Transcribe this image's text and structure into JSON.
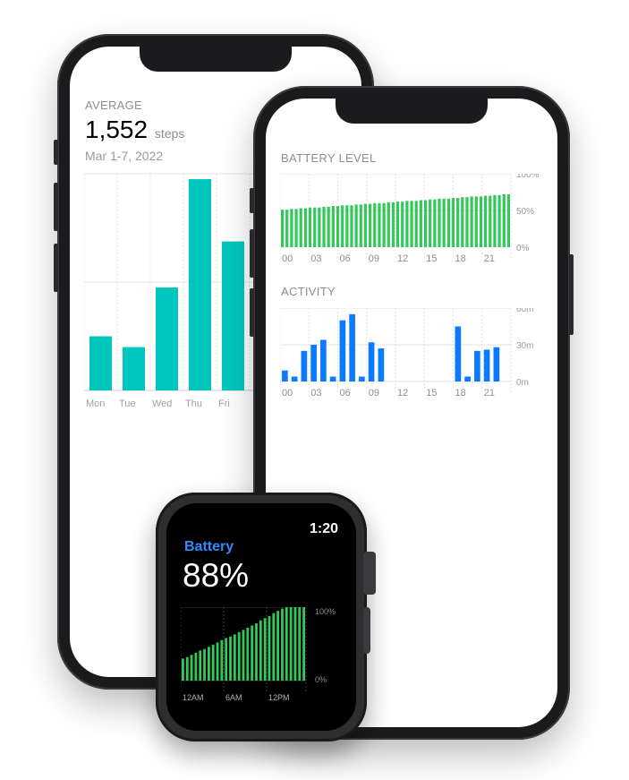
{
  "steps_phone": {
    "label": "AVERAGE",
    "value": "1,552",
    "unit": "steps",
    "date_range": "Mar 1-7, 2022"
  },
  "battery_phone": {
    "battery_title": "BATTERY LEVEL",
    "activity_title": "ACTIVITY"
  },
  "watch": {
    "time": "1:20",
    "title": "Battery",
    "value": "88%"
  },
  "colors": {
    "teal": "#00c7be",
    "green": "#34c759",
    "blue": "#0a7aff",
    "watch_blue": "#2f8cff"
  },
  "chart_data": [
    {
      "type": "bar",
      "categories": [
        "Mon",
        "Tue",
        "Wed",
        "Thu",
        "Fri"
      ],
      "values": [
        1000,
        800,
        1900,
        3900,
        2750
      ],
      "title": "",
      "xlabel": "",
      "ylabel": ""
    },
    {
      "type": "bar",
      "title": "BATTERY LEVEL",
      "x_ticks": [
        "00",
        "03",
        "06",
        "09",
        "12",
        "15",
        "18",
        "21"
      ],
      "y_ticks": [
        "100%",
        "50%",
        "0%"
      ],
      "ylim": [
        0,
        100
      ],
      "values": [
        51,
        51,
        52,
        52,
        53,
        53,
        54,
        54,
        54,
        55,
        55,
        56,
        56,
        57,
        57,
        57,
        58,
        58,
        59,
        59,
        60,
        60,
        60,
        61,
        61,
        62,
        62,
        63,
        63,
        63,
        64,
        64,
        65,
        65,
        66,
        66,
        66,
        67,
        67,
        68,
        68,
        69,
        69,
        69,
        70,
        70,
        71,
        71,
        72,
        72
      ]
    },
    {
      "type": "bar",
      "title": "ACTIVITY",
      "x_ticks": [
        "00",
        "03",
        "06",
        "09",
        "12",
        "15",
        "18",
        "21"
      ],
      "y_ticks": [
        "60m",
        "30m",
        "0m"
      ],
      "ylim": [
        0,
        60
      ],
      "values": [
        9,
        4,
        25,
        30,
        34,
        4,
        50,
        55,
        4,
        32,
        27,
        0,
        0,
        0,
        0,
        0,
        0,
        0,
        45,
        4,
        25,
        26,
        28,
        0
      ]
    },
    {
      "type": "bar",
      "title": "Battery",
      "x_ticks": [
        "12AM",
        "6AM",
        "12PM"
      ],
      "y_ticks": [
        "100%",
        "0%"
      ],
      "ylim": [
        0,
        100
      ],
      "values": [
        30,
        32,
        35,
        38,
        41,
        43,
        46,
        49,
        52,
        55,
        58,
        60,
        63,
        66,
        69,
        72,
        75,
        78,
        82,
        85,
        88,
        92,
        95,
        98,
        100,
        100,
        100,
        100,
        100
      ]
    }
  ]
}
